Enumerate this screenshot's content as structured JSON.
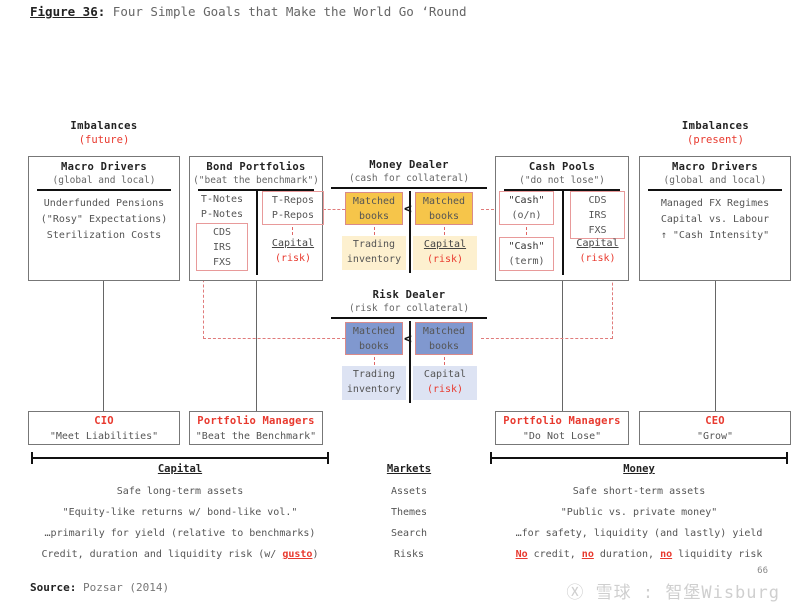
{
  "figure": {
    "label": "Figure 36",
    "colon": ":",
    "title": "Four Simple Goals that Make the World Go ‘Round"
  },
  "captions": {
    "left": {
      "heading": "Imbalances",
      "sub": "(future)"
    },
    "right": {
      "heading": "Imbalances",
      "sub": "(present)"
    }
  },
  "panels": {
    "macro_left": {
      "heading": "Macro Drivers",
      "sub": "(global and local)",
      "lines": [
        "Underfunded Pensions",
        "(\"Rosy\" Expectations)",
        "Sterilization Costs"
      ]
    },
    "bond_portfolios": {
      "heading": "Bond Portfolios",
      "sub": "(\"beat the benchmark\")",
      "left_top": [
        "T-Notes",
        "P-Notes"
      ],
      "left_box": [
        "CDS",
        "IRS",
        "FXS"
      ],
      "right_top": [
        "T-Repos",
        "P-Repos"
      ],
      "right_capital": "Capital",
      "right_risk": "(risk)"
    },
    "money_dealer": {
      "heading": "Money Dealer",
      "sub": "(cash for collateral)",
      "left_cell": [
        "Matched",
        "books"
      ],
      "right_cell": [
        "Matched",
        "books"
      ],
      "left_lower": [
        "Trading",
        "inventory"
      ],
      "right_lower_capital": "Capital",
      "right_lower_risk": "(risk)",
      "arrow": "<"
    },
    "risk_dealer": {
      "heading": "Risk Dealer",
      "sub": "(risk for collateral)",
      "left_cell": [
        "Matched",
        "books"
      ],
      "right_cell": [
        "Matched",
        "books"
      ],
      "left_lower": [
        "Trading",
        "inventory"
      ],
      "right_lower_capital": "Capital",
      "right_lower_risk": "(risk)",
      "arrow": "<"
    },
    "cash_pools": {
      "heading": "Cash Pools",
      "sub": "(\"do not lose\")",
      "left_top": [
        "\"Cash\"",
        "(o/n)"
      ],
      "left_bottom": [
        "\"Cash\"",
        "(term)"
      ],
      "right_box": [
        "CDS",
        "IRS",
        "FXS"
      ],
      "right_capital": "Capital",
      "right_risk": "(risk)"
    },
    "macro_right": {
      "heading": "Macro Drivers",
      "sub": "(global and local)",
      "lines": [
        "Managed FX Regimes",
        "Capital vs. Labour",
        "↑ \"Cash Intensity\""
      ]
    }
  },
  "roles": [
    {
      "title": "CIO",
      "sub": "\"Meet Liabilities\""
    },
    {
      "title": "Portfolio Managers",
      "sub": "\"Beat the Benchmark\""
    },
    {
      "title": "Portfolio Managers",
      "sub": "\"Do Not Lose\""
    },
    {
      "title": "CEO",
      "sub": "\"Grow\""
    }
  ],
  "bottom": {
    "capital": {
      "heading": "Capital",
      "rows": [
        {
          "text": "Safe long-term assets"
        },
        {
          "text": "\"Equity-like returns w/ bond-like vol.\""
        },
        {
          "text": "…primarily for yield (relative to benchmarks)"
        },
        {
          "pre": "Credit, duration and liquidity risk (w/ ",
          "em": "gusto",
          "post": ")"
        }
      ]
    },
    "markets": {
      "heading": "Markets",
      "rows": [
        "Assets",
        "Themes",
        "Search",
        "Risks"
      ]
    },
    "money": {
      "heading": "Money",
      "rows": [
        {
          "text": "Safe short-term assets"
        },
        {
          "text": "\"Public vs. private money\""
        },
        {
          "text": "…for safety, liquidity (and lastly) yield"
        },
        {
          "em1": "No",
          "mid1": " credit, ",
          "em2": "no",
          "mid2": " duration, ",
          "em3": "no",
          "post": " liquidity risk"
        }
      ]
    }
  },
  "footer": {
    "source_label": "Source:",
    "source_value": "Pozsar (2014)",
    "page_number": "66",
    "watermark": "Ⓧ 雪球 : 智堡Wisburg"
  },
  "colors": {
    "accent_red": "#e8392e",
    "money_dealer_fill": "#f6c54a",
    "money_dealer_light": "#fdf0cf",
    "risk_dealer_fill": "#8098cf",
    "risk_dealer_light": "#dde3f3",
    "connector_red": "#e07b7b",
    "connector_black": "#666666"
  }
}
